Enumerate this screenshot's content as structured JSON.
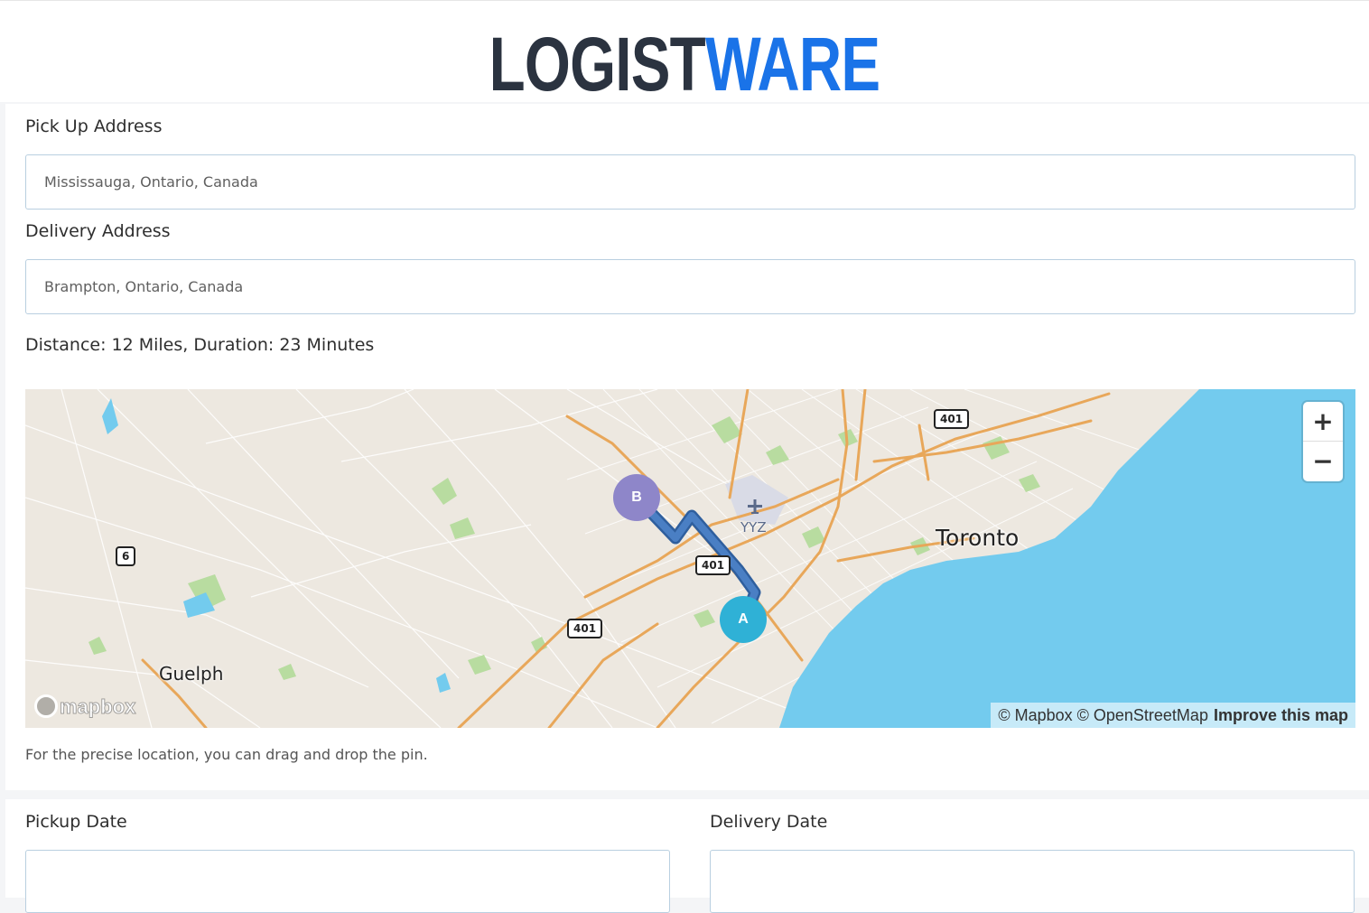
{
  "brand": {
    "logo_part1": "LOGIST",
    "logo_part2": "WARE"
  },
  "form": {
    "pickup_label": "Pick Up Address",
    "pickup_value": "Mississauga, Ontario, Canada",
    "delivery_label": "Delivery Address",
    "delivery_value": "Brampton, Ontario, Canada",
    "distance_text": "Distance: 12 Miles, Duration: 23 Minutes",
    "hint": "For the precise location, you can drag and drop the pin.",
    "pickup_date_label": "Pickup Date",
    "delivery_date_label": "Delivery Date"
  },
  "map": {
    "city_labels": [
      "Toronto",
      "Guelph"
    ],
    "airport_label": "YYZ",
    "highway_shields": [
      "401",
      "401",
      "401",
      "6"
    ],
    "pin_a": "A",
    "pin_b": "B",
    "zoom_in": "+",
    "zoom_out": "−",
    "attribution": "© Mapbox © OpenStreetMap",
    "improve": "Improve this map",
    "logo": "mapbox",
    "colors": {
      "land": "#ede8e0",
      "water": "#73cbee",
      "roads_major": "#e8a75a",
      "parks": "#b8dca0",
      "route": "#3a6eb5",
      "pin_a": "#2fb1d6",
      "pin_b": "#8e86c9"
    }
  },
  "colors": {
    "logo_dark": "#2b3340",
    "logo_blue": "#1a73e8"
  }
}
